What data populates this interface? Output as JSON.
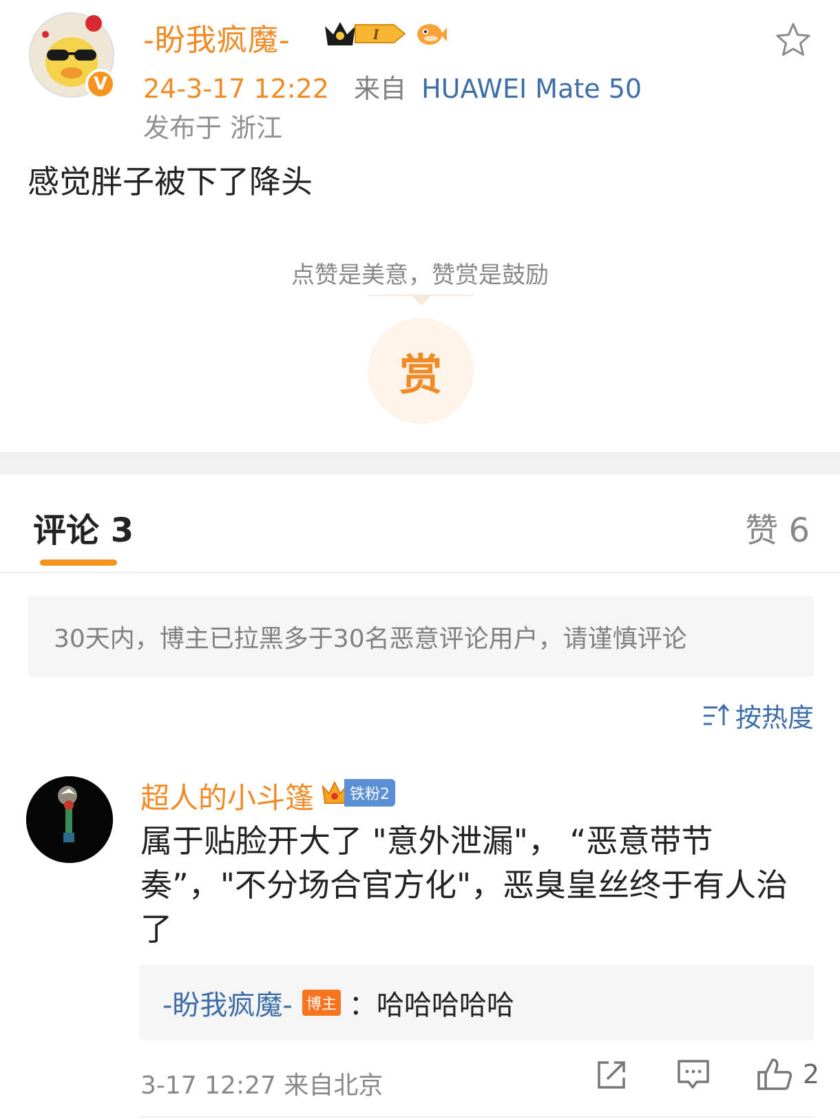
{
  "post": {
    "author": "-盼我疯魔-",
    "verified_badge": "V",
    "level_badge": "I",
    "timestamp": "24-3-17 12:22",
    "source_label": "来自",
    "device": "HUAWEI Mate 50",
    "location": "发布于 浙江",
    "text": "感觉胖子被下了降头",
    "reward_tip": "点赞是美意，赞赏是鼓励",
    "reward_button": "赏"
  },
  "tabs": {
    "comments": "评论 3",
    "likes": "赞 6"
  },
  "notice": "30天内，博主已拉黑多于30名恶意评论用户，请谨慎评论",
  "sort_label": "按热度",
  "comment": {
    "author": "超人的小斗篷",
    "fan_badge": "铁粉2",
    "text": "属于贴脸开大了 \"意外泄漏\"，  “恶意带节奏”，\"不分场合官方化\"，恶臭皇丝终于有人治了",
    "reply": {
      "author": "-盼我疯魔-",
      "tag": "博主",
      "text": "：哈哈哈哈哈"
    },
    "footer": "3-17 12:27 来自北京",
    "like_count": "2"
  },
  "colors": {
    "accent_orange": "#f08a24",
    "link_blue": "#3d6ea8",
    "muted_gray": "#888888"
  },
  "icons": [
    "star-icon",
    "share-icon",
    "comment-icon",
    "like-icon",
    "sort-icon",
    "crown-icon",
    "fish-icon"
  ]
}
